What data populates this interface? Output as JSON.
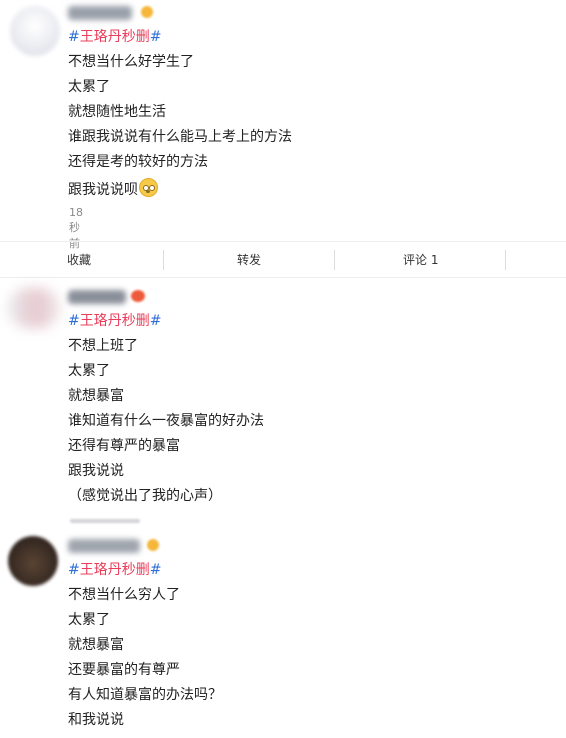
{
  "posts": [
    {
      "topic": "王珞丹秒删",
      "lines": [
        "不想当什么好学生了",
        "太累了",
        "就想随性地生活",
        "谁跟我说说有什么能马上考上的方法",
        "还得是考的较好的方法",
        "跟我说说呗"
      ],
      "time": "18秒前"
    },
    {
      "topic": "王珞丹秒删",
      "lines": [
        "不想上班了",
        "太累了",
        "就想暴富",
        "谁知道有什么一夜暴富的好办法",
        "还得有尊严的暴富",
        "跟我说说",
        "（感觉说出了我的心声）"
      ]
    },
    {
      "topic": "王珞丹秒删",
      "lines": [
        "不想当什么穷人了",
        "太累了",
        "就想暴富",
        "还要暴富的有尊严",
        "有人知道暴富的办法吗？",
        "和我说说"
      ]
    }
  ],
  "actions": {
    "collect": "收藏",
    "repost": "转发",
    "comment": "评论 1"
  },
  "hash_symbol": "#",
  "colors": {
    "topic": "#eb3c5a",
    "hash": "#2f6fd6",
    "badge_gold": "#f5b63a",
    "badge_red": "#ee5a3a"
  },
  "icons": {
    "emoji": "blushing-face-emoji-icon"
  }
}
